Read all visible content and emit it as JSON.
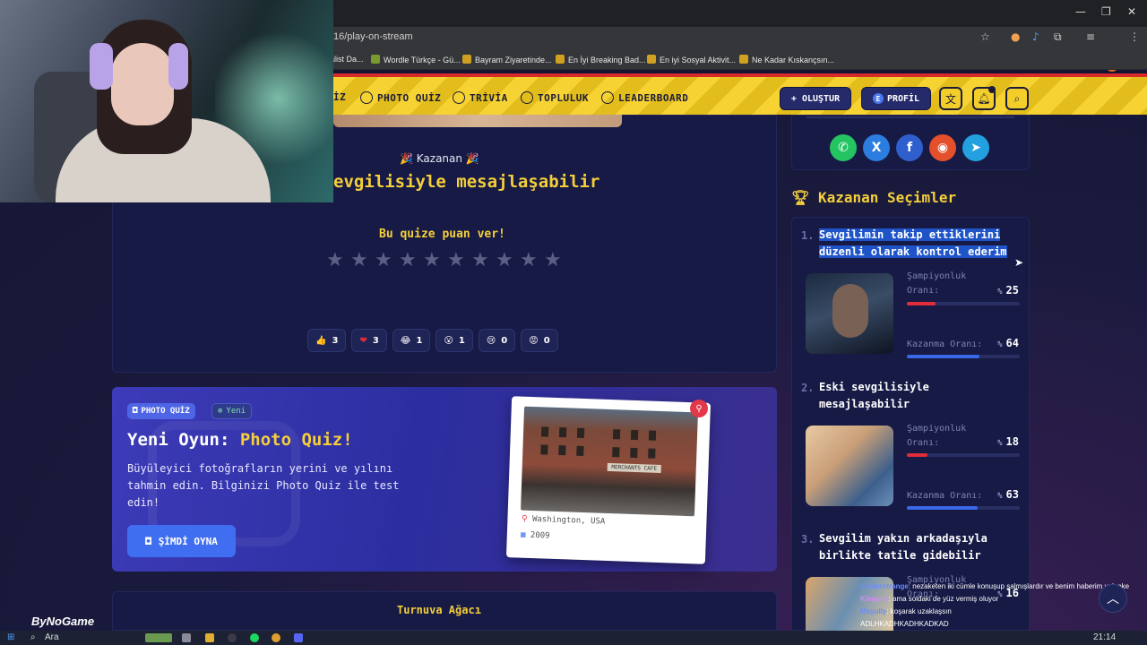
{
  "browser": {
    "url": "16/play-on-stream",
    "bookmarks": [
      "alist Da...",
      "Wordle Türkçe - Gü...",
      "Bayram Ziyaretinde...",
      "En İyi Breaking Bad...",
      "En iyi Sosyal Aktivit...",
      "Ne Kadar Kıskançsın..."
    ]
  },
  "nav": {
    "links": [
      "İZ",
      "PHOTO QUİZ",
      "TRİVİA",
      "TOPLULUK",
      "LEADERBOARD"
    ],
    "create_label": "+ OLUŞTUR",
    "profile_badge": "E",
    "profile_label": "PROFİL",
    "notification_count": "0"
  },
  "result": {
    "winner_label": "Kazanan",
    "winner_title": "evgilisiyle mesajlaşabilir",
    "rate_prompt": "Bu quize puan ver!",
    "star_count": 10,
    "reactions": [
      {
        "emoji": "👍",
        "count": "3"
      },
      {
        "emoji": "❤",
        "count": "3"
      },
      {
        "emoji": "😂",
        "count": "1"
      },
      {
        "emoji": "😮",
        "count": "1"
      },
      {
        "emoji": "😢",
        "count": "0"
      },
      {
        "emoji": "😡",
        "count": "0"
      }
    ]
  },
  "promo": {
    "chip_label": "PHOTO QUİZ",
    "new_label": "Yeni",
    "title_prefix": "Yeni Oyun: ",
    "title_highlight": "Photo Quiz!",
    "description": "Büyüleyici fotoğrafların yerini ve yılını tahmin edin. Bilginizi Photo Quiz ile test edin!",
    "button_label": "ŞİMDİ OYNA",
    "photo_location": "Washington, USA",
    "photo_year": "2009",
    "photo_sign": "MERCHANTS CAFE"
  },
  "bracket": {
    "title": "Turnuva Ağacı"
  },
  "sidebar": {
    "winners_title": "Kazanan Seçimler",
    "choices": [
      {
        "num": "1.",
        "text": "Sevgilimin takip ettiklerini düzenli olarak kontrol ederim",
        "champ_label": "Şampiyonluk Oranı:",
        "champ_value": "25",
        "win_label": "Kazanma Oranı:",
        "win_value": "64"
      },
      {
        "num": "2.",
        "text": "Eski sevgilisiyle mesajlaşabilir",
        "champ_label": "Şampiyonluk Oranı:",
        "champ_value": "18",
        "win_label": "Kazanma Oranı:",
        "win_value": "63"
      },
      {
        "num": "3.",
        "text": "Sevgilim yakın arkadaşıyla birlikte tatile gidebilir",
        "champ_label": "Şampiyonluk Oranı:",
        "champ_value": "16"
      }
    ],
    "pct_symbol": "%"
  },
  "chat": [
    {
      "user": "doctorstrange",
      "msg": ": nezaketen iki cümle konuşup salmışlardır ve benim haberim yok oke"
    },
    {
      "user": "Klegoos",
      "msg": ": ama soldaki de yüz vermiş oluyor"
    },
    {
      "user": "Mayully",
      "msg": ": koşarak uzaklaşsın"
    },
    {
      "user": "",
      "msg": "ADLHKADHKADHKADKAD"
    }
  ],
  "stream_brand": "ByNoGame",
  "taskbar": {
    "search": "Ara",
    "time": "21:14"
  }
}
